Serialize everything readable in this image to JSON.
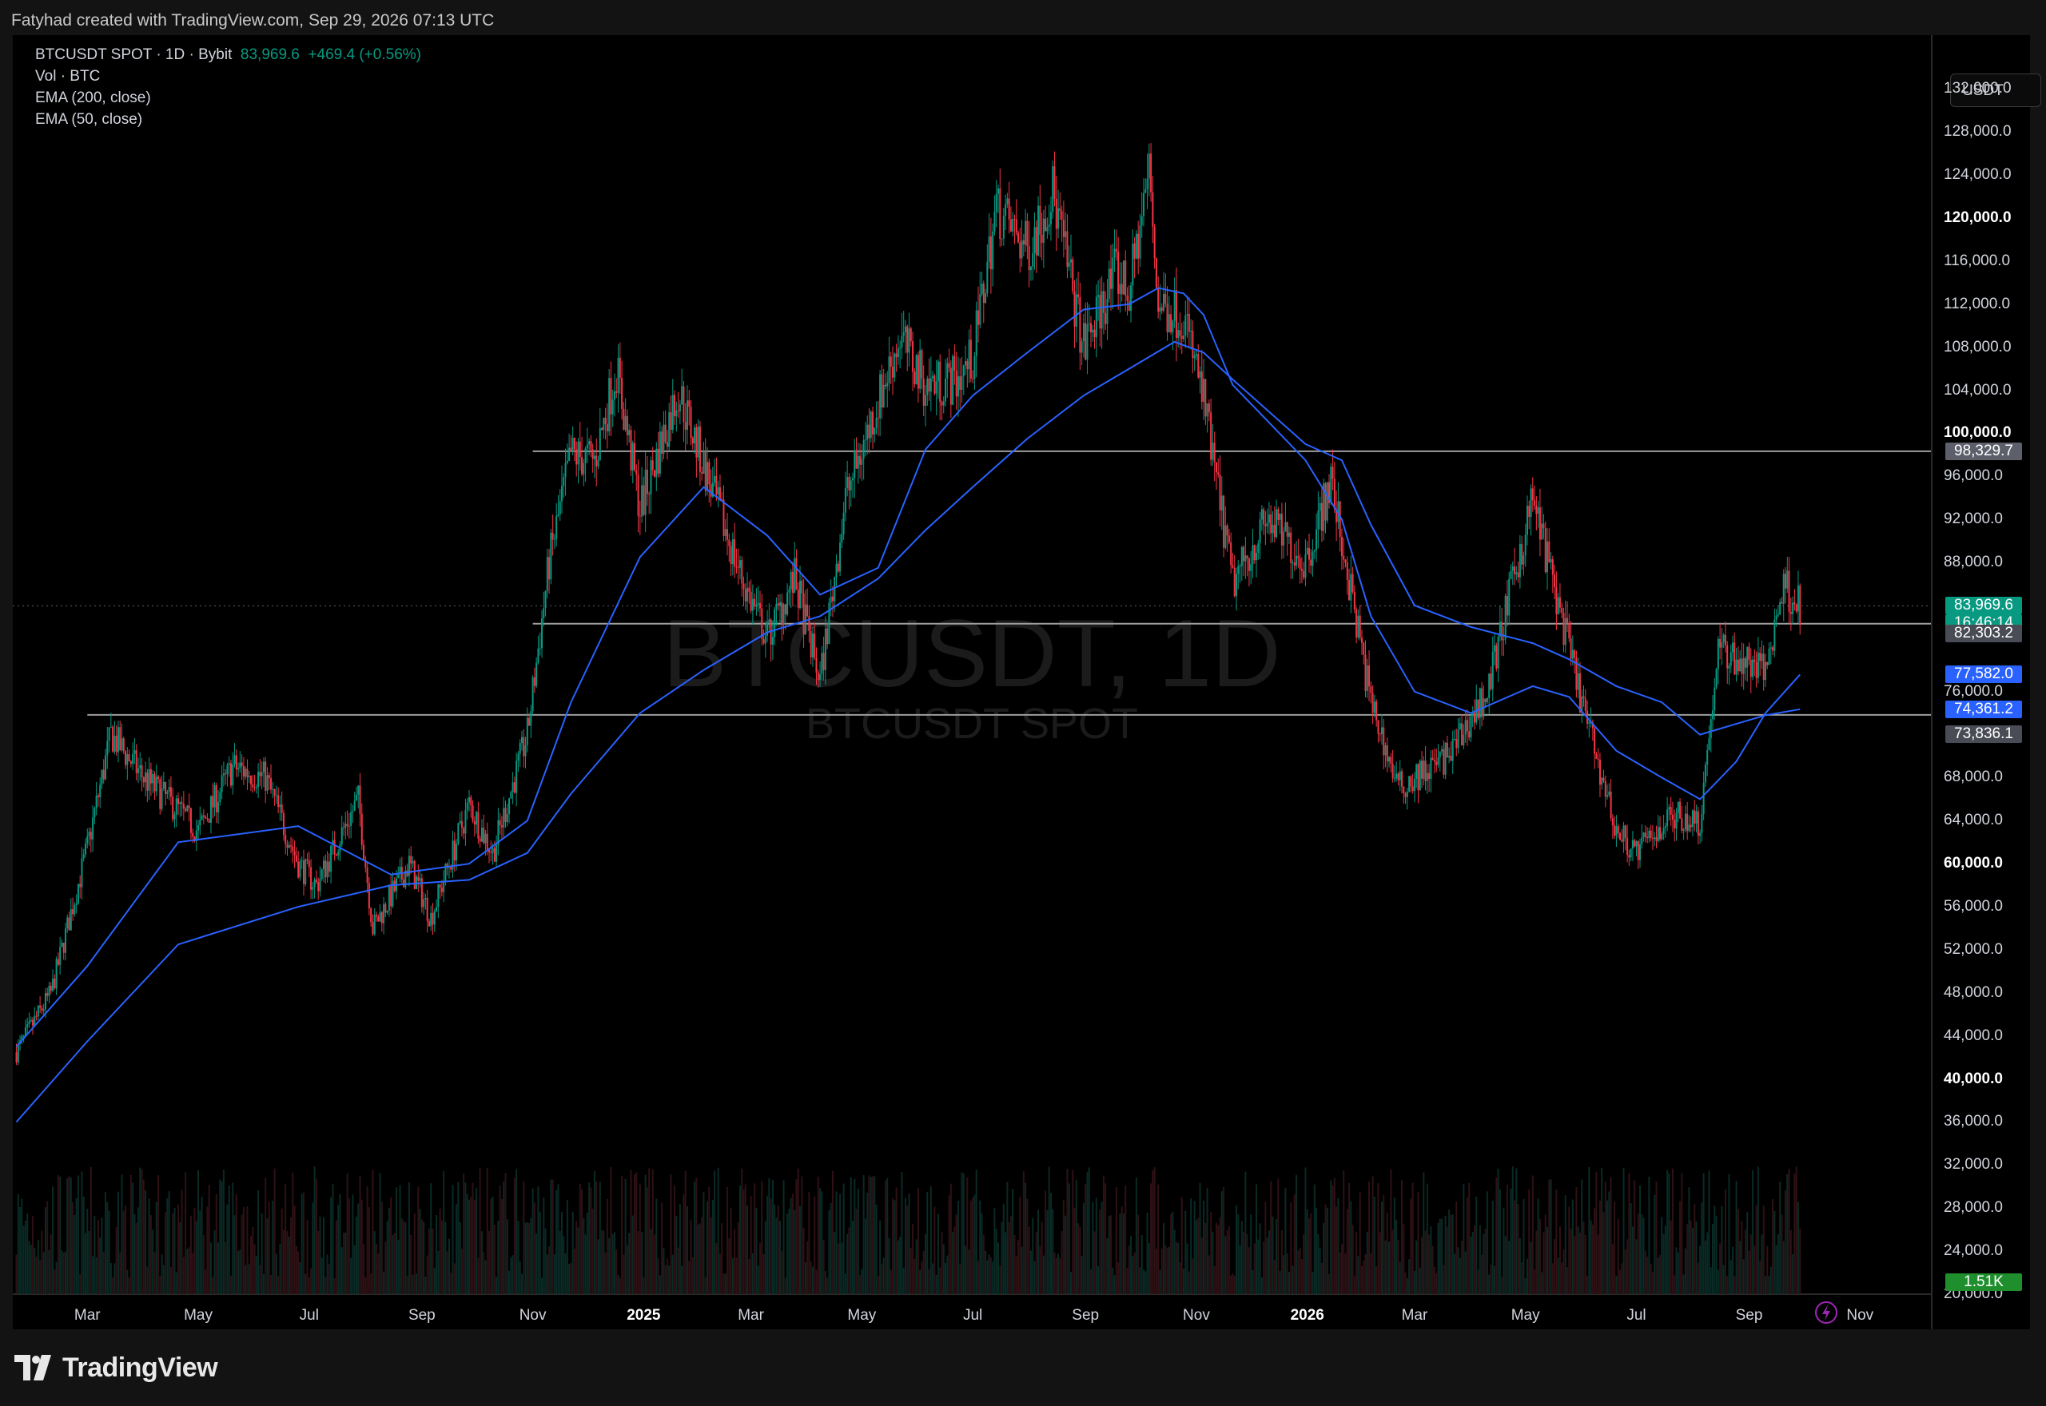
{
  "header": {
    "caption": "Fatyhad created with TradingView.com, Sep 29, 2026 07:13 UTC"
  },
  "legend": {
    "symbol_line": "BTCUSDT SPOT · 1D · Bybit",
    "last_price": "83,969.6",
    "change": "+469.4 (+0.56%)",
    "volume": "Vol · BTC",
    "ema200": "EMA (200, close)",
    "ema50": "EMA (50, close)"
  },
  "watermark": {
    "title": "BTCUSDT, 1D",
    "subtitle": "BTCUSDT SPOT"
  },
  "currency": "USDT",
  "badges": {
    "level_top": "98,329.7",
    "last_price": "83,969.6",
    "countdown": "16:46:14",
    "level_mid": "82,303.2",
    "ema50": "77,582.0",
    "ema200": "74,361.2",
    "level_low": "73,836.1",
    "volume": "1.51K"
  },
  "colors": {
    "up": "#089981",
    "down": "#f23645",
    "ema": "#2962ff",
    "level_line": "#9e9e9e",
    "badge_gray": "#5d606b",
    "background": "#000000"
  },
  "footer": {
    "logo": "TradingView"
  },
  "chart_data": {
    "type": "line",
    "title": "BTCUSDT, 1D",
    "y_axis_ticks": [
      "132,000.0",
      "128,000.0",
      "124,000.0",
      "120,000.0",
      "116,000.0",
      "112,000.0",
      "108,000.0",
      "104,000.0",
      "100,000.0",
      "96,000.0",
      "92,000.0",
      "88,000.0",
      "76,000.0",
      "68,000.0",
      "64,000.0",
      "60,000.0",
      "56,000.0",
      "52,000.0",
      "48,000.0",
      "44,000.0",
      "40,000.0",
      "36,000.0",
      "32,000.0",
      "28,000.0",
      "24,000.0",
      "20,000.0"
    ],
    "y_axis_bold": [
      "120,000.0",
      "100,000.0",
      "60,000.0",
      "40,000.0"
    ],
    "x_axis_ticks": [
      {
        "label": "Mar",
        "date": "2024-03-01"
      },
      {
        "label": "May",
        "date": "2024-05-01"
      },
      {
        "label": "Jul",
        "date": "2024-07-01"
      },
      {
        "label": "Sep",
        "date": "2024-09-01"
      },
      {
        "label": "Nov",
        "date": "2024-11-01"
      },
      {
        "label": "2025",
        "date": "2025-01-01",
        "bold": true
      },
      {
        "label": "Mar",
        "date": "2025-03-01"
      },
      {
        "label": "May",
        "date": "2025-05-01"
      },
      {
        "label": "Jul",
        "date": "2025-07-01"
      },
      {
        "label": "Sep",
        "date": "2025-09-01"
      },
      {
        "label": "Nov",
        "date": "2025-11-01"
      },
      {
        "label": "2026",
        "date": "2026-01-01",
        "bold": true
      },
      {
        "label": "Mar",
        "date": "2026-03-01"
      },
      {
        "label": "May",
        "date": "2026-05-01"
      },
      {
        "label": "Jul",
        "date": "2026-07-01"
      },
      {
        "label": "Sep",
        "date": "2026-09-01"
      },
      {
        "label": "Nov",
        "date": "2026-11-01"
      }
    ],
    "ylim": [
      20000,
      137000
    ],
    "xlim": [
      "2024-01-20",
      "2026-12-10"
    ],
    "grid": false,
    "horizontal_levels": [
      {
        "value": 98329.7,
        "from": "2024-11-01"
      },
      {
        "value": 82303.2,
        "from": "2024-11-01"
      },
      {
        "value": 73836.1,
        "from": "2024-03-01"
      }
    ],
    "series": [
      {
        "name": "BTCUSDT SPOT",
        "x": [
          "2024-01-22",
          "2024-02-10",
          "2024-03-01",
          "2024-03-14",
          "2024-04-01",
          "2024-04-20",
          "2024-05-01",
          "2024-05-20",
          "2024-06-07",
          "2024-06-25",
          "2024-07-05",
          "2024-07-28",
          "2024-08-05",
          "2024-08-25",
          "2024-09-06",
          "2024-09-27",
          "2024-10-10",
          "2024-10-29",
          "2024-11-10",
          "2024-11-22",
          "2024-12-05",
          "2024-12-17",
          "2024-12-30",
          "2025-01-20",
          "2025-02-03",
          "2025-02-25",
          "2025-03-10",
          "2025-03-25",
          "2025-04-08",
          "2025-04-22",
          "2025-05-10",
          "2025-05-22",
          "2025-06-05",
          "2025-06-22",
          "2025-07-01",
          "2025-07-14",
          "2025-07-31",
          "2025-08-14",
          "2025-08-31",
          "2025-09-18",
          "2025-09-25",
          "2025-10-06",
          "2025-10-11",
          "2025-10-25",
          "2025-11-05",
          "2025-11-21",
          "2025-12-10",
          "2025-12-31",
          "2026-01-14",
          "2026-02-05",
          "2026-02-20",
          "2026-03-20",
          "2026-04-10",
          "2026-05-05",
          "2026-06-01",
          "2026-06-20",
          "2026-07-01",
          "2026-07-20",
          "2026-08-05",
          "2026-08-15",
          "2026-08-25",
          "2026-09-10",
          "2026-09-20",
          "2026-09-29"
        ],
        "y": [
          42500,
          48000,
          61500,
          72000,
          68000,
          65000,
          63000,
          69000,
          68000,
          60000,
          58000,
          66000,
          54000,
          60000,
          55000,
          65500,
          61000,
          72000,
          88000,
          98000,
          97500,
          106000,
          93000,
          104000,
          97000,
          86000,
          81000,
          86500,
          77000,
          94000,
          103000,
          109000,
          104500,
          105000,
          107000,
          121000,
          117000,
          122500,
          108000,
          115000,
          113000,
          124500,
          112000,
          111000,
          103000,
          86000,
          92000,
          88000,
          95500,
          75000,
          67000,
          70000,
          76000,
          94000,
          75000,
          63000,
          61000,
          64500,
          64000,
          80000,
          79000,
          78000,
          86000,
          83969.6
        ]
      },
      {
        "name": "EMA (50, close)",
        "x": [
          "2024-01-22",
          "2024-03-01",
          "2024-04-20",
          "2024-06-25",
          "2024-08-15",
          "2024-09-27",
          "2024-10-29",
          "2024-11-22",
          "2024-12-30",
          "2025-02-03",
          "2025-03-10",
          "2025-04-08",
          "2025-05-10",
          "2025-06-05",
          "2025-07-01",
          "2025-07-31",
          "2025-08-31",
          "2025-09-25",
          "2025-10-11",
          "2025-10-25",
          "2025-11-05",
          "2025-11-21",
          "2025-12-31",
          "2026-01-20",
          "2026-02-05",
          "2026-03-01",
          "2026-04-01",
          "2026-05-05",
          "2026-05-25",
          "2026-06-20",
          "2026-07-15",
          "2026-08-05",
          "2026-08-25",
          "2026-09-10",
          "2026-09-29"
        ],
        "y": [
          43000,
          50500,
          62000,
          63500,
          59000,
          60000,
          64000,
          75000,
          88500,
          95000,
          90500,
          85000,
          87500,
          98500,
          103500,
          107500,
          111500,
          112000,
          113500,
          113000,
          111000,
          104500,
          97500,
          92000,
          83000,
          76000,
          74000,
          76500,
          75500,
          70500,
          68000,
          66000,
          69500,
          74000,
          77582
        ]
      },
      {
        "name": "EMA (200, close)",
        "x": [
          "2024-01-22",
          "2024-03-01",
          "2024-04-20",
          "2024-06-25",
          "2024-08-15",
          "2024-09-27",
          "2024-10-29",
          "2024-11-22",
          "2024-12-30",
          "2025-02-03",
          "2025-03-10",
          "2025-04-08",
          "2025-05-10",
          "2025-06-05",
          "2025-07-01",
          "2025-07-31",
          "2025-08-31",
          "2025-09-25",
          "2025-10-20",
          "2025-11-05",
          "2025-11-21",
          "2025-12-31",
          "2026-01-20",
          "2026-02-05",
          "2026-03-01",
          "2026-04-01",
          "2026-05-05",
          "2026-05-25",
          "2026-06-20",
          "2026-07-15",
          "2026-08-05",
          "2026-08-25",
          "2026-09-10",
          "2026-09-29"
        ],
        "y": [
          36000,
          43500,
          52500,
          56000,
          58000,
          58500,
          61000,
          66500,
          74000,
          78000,
          81500,
          83000,
          86500,
          91000,
          95000,
          99500,
          103500,
          106000,
          108500,
          107500,
          105000,
          99000,
          97500,
          91500,
          84000,
          82000,
          80500,
          79000,
          76500,
          75000,
          72000,
          73000,
          73800,
          74361
        ]
      }
    ]
  }
}
